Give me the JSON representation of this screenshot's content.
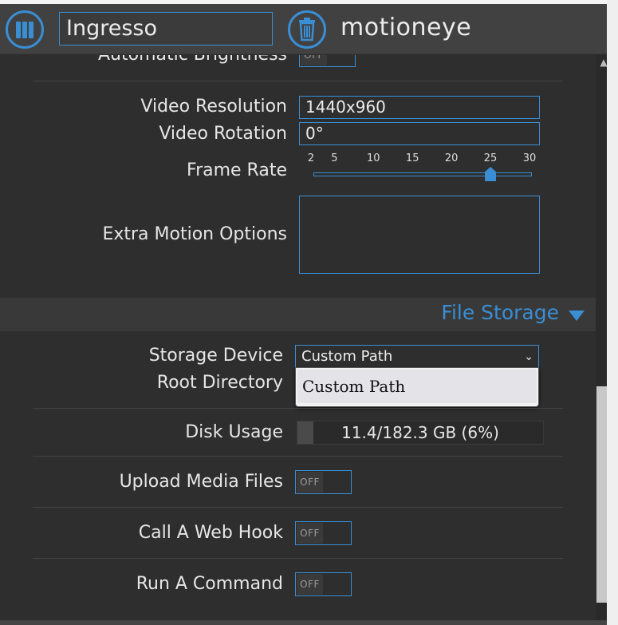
{
  "header": {
    "camera_name": "Ingresso",
    "app_title": "motioneye"
  },
  "video": {
    "automatic_brightness_label": "Automatic Brightness",
    "automatic_brightness_state": "OFF",
    "resolution_label": "Video Resolution",
    "resolution_value": "1440x960",
    "rotation_label": "Video Rotation",
    "rotation_value": "0°",
    "frame_rate_label": "Frame Rate",
    "frame_rate_ticks": [
      "2",
      "5",
      "10",
      "15",
      "20",
      "25",
      "30"
    ],
    "frame_rate_value": 25,
    "extra_motion_label": "Extra Motion Options",
    "extra_motion_value": ""
  },
  "file_storage": {
    "section_title": "File Storage",
    "storage_device_label": "Storage Device",
    "storage_device_value": "Custom Path",
    "storage_device_options": [
      "Custom Path"
    ],
    "root_directory_label": "Root Directory",
    "disk_usage_label": "Disk Usage",
    "disk_usage_text": "11.4/182.3 GB (6%)",
    "disk_usage_fraction": 0.06,
    "upload_media_label": "Upload Media Files",
    "upload_media_state": "OFF",
    "web_hook_label": "Call A Web Hook",
    "web_hook_state": "OFF",
    "run_command_label": "Run A Command",
    "run_command_state": "OFF"
  },
  "colors": {
    "accent": "#3a8ed4",
    "background": "#2e2e2e",
    "header_bg": "#414141"
  },
  "icons": {
    "menu": "menu-icon",
    "trash": "trash-icon",
    "caret": "caret-down-icon",
    "chevron": "chevron-down-icon"
  }
}
